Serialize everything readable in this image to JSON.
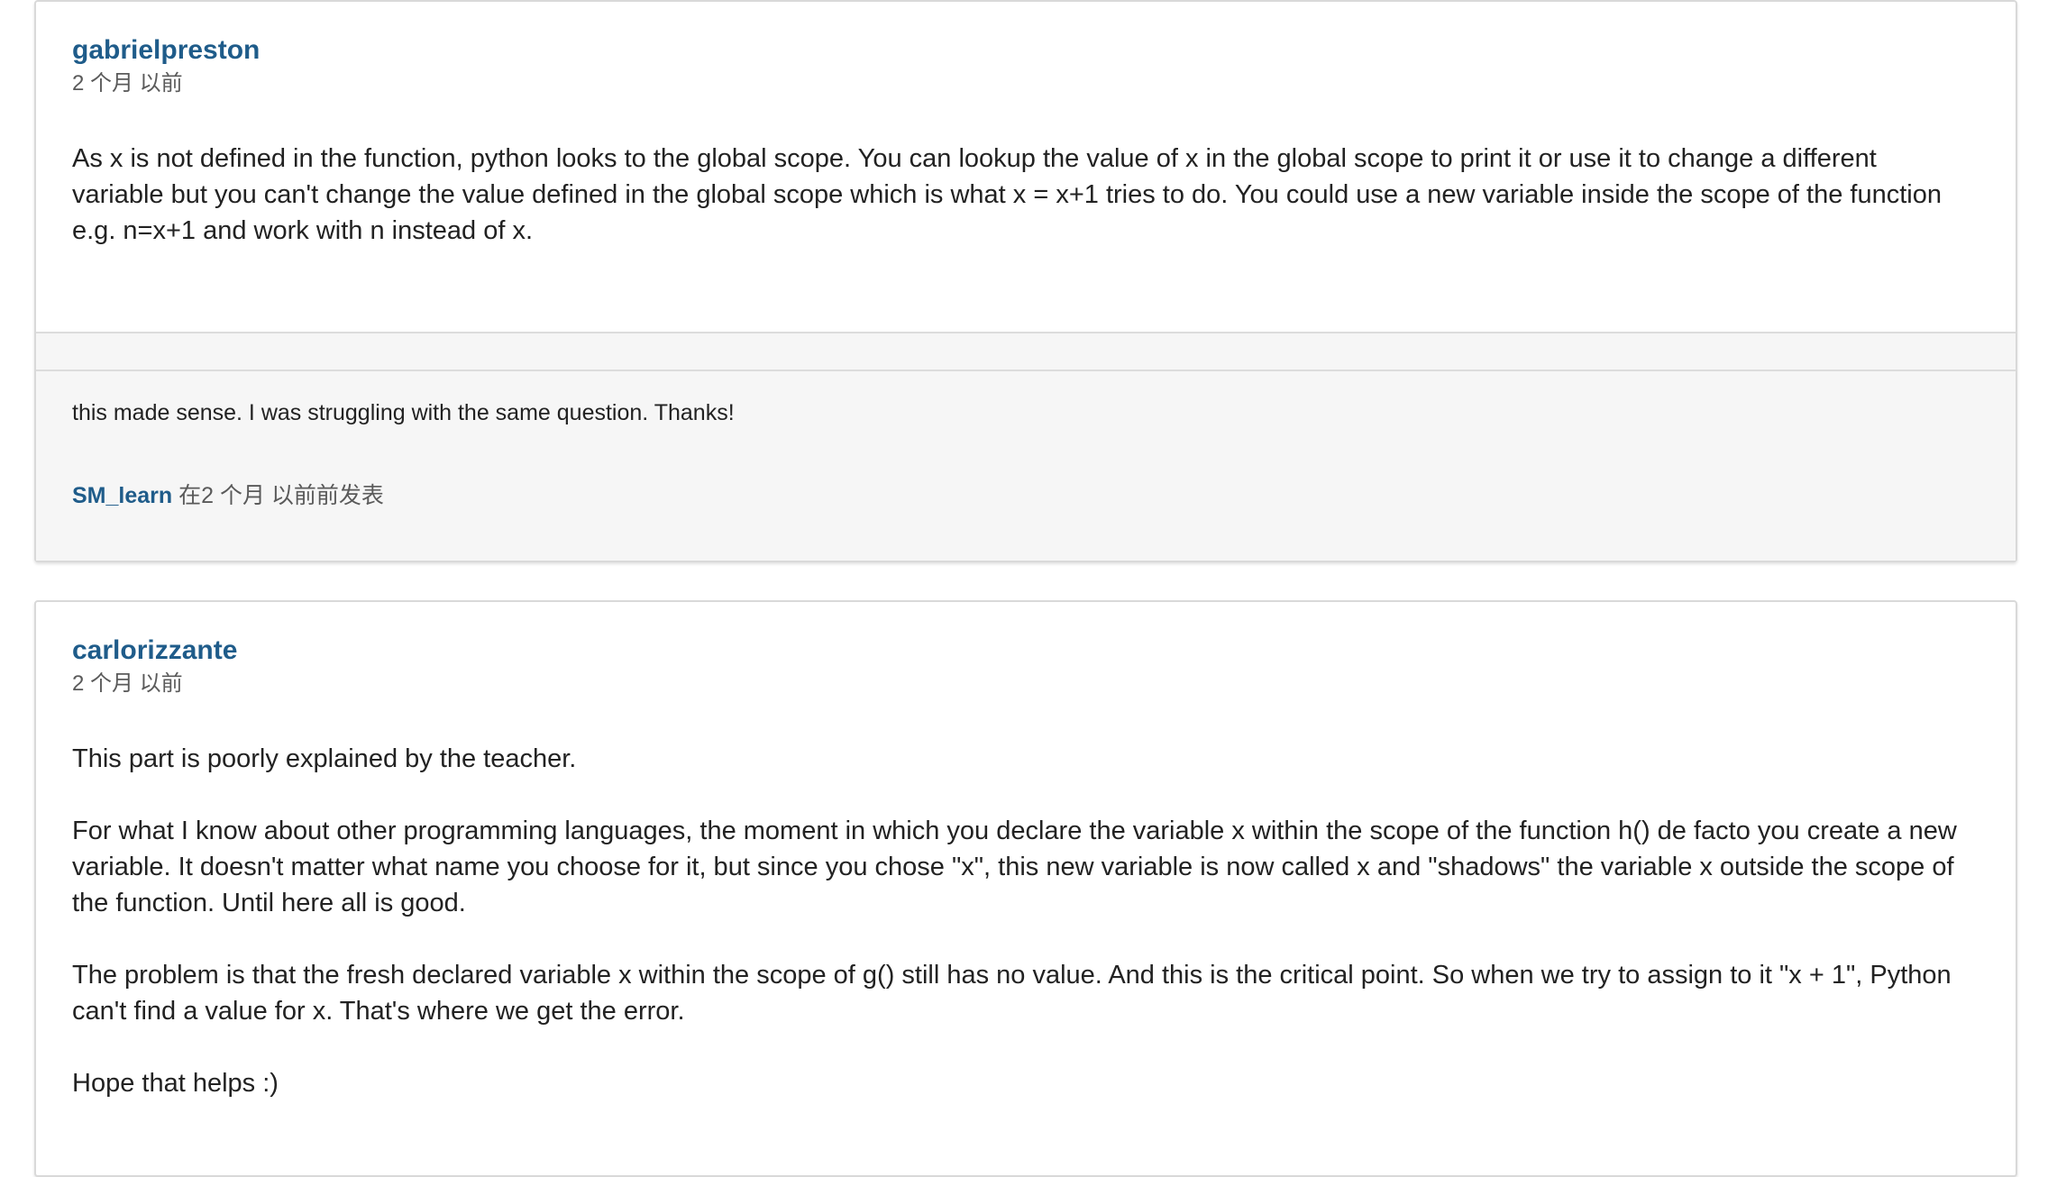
{
  "posts": [
    {
      "author": "gabrielpreston",
      "time": "2 个月 以前",
      "paragraphs": [
        "As x is not defined in the function, python looks to the global scope. You can lookup the value of x in the global scope to print it or use it to change a different variable but you can't change the value defined in the global scope which is what x = x+1 tries to do. You could use a new variable inside the scope of the function e.g. n=x+1 and work with n instead of x."
      ],
      "comments": [
        {
          "text": "this made sense. I was struggling with the same question. Thanks!",
          "author": "SM_learn",
          "meta": "在2 个月 以前前发表"
        }
      ]
    },
    {
      "author": "carlorizzante",
      "time": "2 个月 以前",
      "paragraphs": [
        "This part is poorly explained by the teacher.",
        "For what I know about other programming languages, the moment in which you declare the variable x within the scope of the function h() de facto you create a new variable. It doesn't matter what name you choose for it, but since you chose \"x\", this new variable is now called x and \"shadows\" the variable x outside the scope of the function. Until here all is good.",
        "The problem is that the fresh declared variable x within the scope of g() still has no value. And this is the critical point. So when we try to assign to it \"x + 1\", Python can't find a value for x. That's where we get the error.",
        "Hope that helps :)"
      ]
    }
  ]
}
